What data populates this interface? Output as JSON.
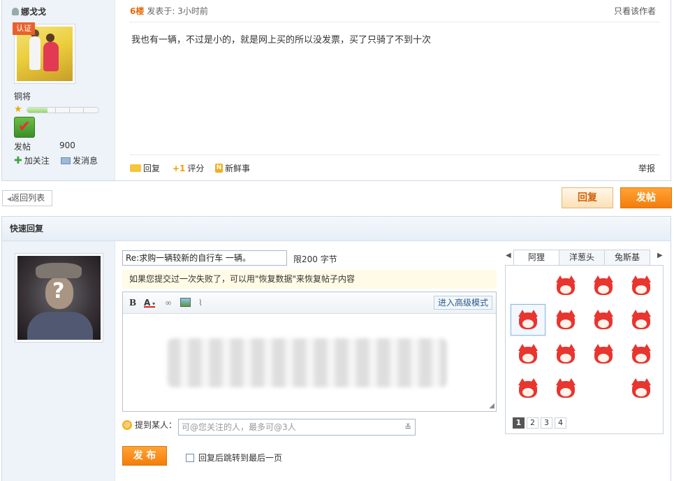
{
  "post": {
    "username": "娜戈戈",
    "badge": "认证",
    "rank": "铜将",
    "posts_label": "发帖",
    "posts_count": "900",
    "follow_label": "加关注",
    "message_label": "发消息",
    "floor": "6楼",
    "posted_at": "发表于: 3小时前",
    "only_author": "只看该作者",
    "content": "我也有一辆，不过是小的，就是网上买的所以没发票，买了只骑了不到十次",
    "actions": {
      "reply": "回复",
      "rate": "评分",
      "share": "新鲜事",
      "report": "举报"
    }
  },
  "nav": {
    "back": "返回列表",
    "reply": "回复",
    "post": "发帖"
  },
  "quick_reply": {
    "title": "快速回复",
    "subject": "Re:求购一辆较新的自行车 一辆。",
    "limit": "限200 字节",
    "restore_tip": "如果您提交过一次失败了，可以用\"恢复数据\"来恢复帖子内容",
    "toolbar": {
      "bold": "B",
      "color": "A",
      "advanced": "进入高级模式"
    },
    "mention_label": "提到某人：",
    "mention_placeholder": "可@您关注的人，最多可@3人",
    "submit": "发 布",
    "jump_last": "回复后跳转到最后一页"
  },
  "emoticons": {
    "tabs": [
      "阿狸",
      "洋葱头",
      "兔斯基"
    ],
    "active_tab": 0,
    "pages": [
      "1",
      "2",
      "3",
      "4"
    ],
    "current_page": "1"
  }
}
